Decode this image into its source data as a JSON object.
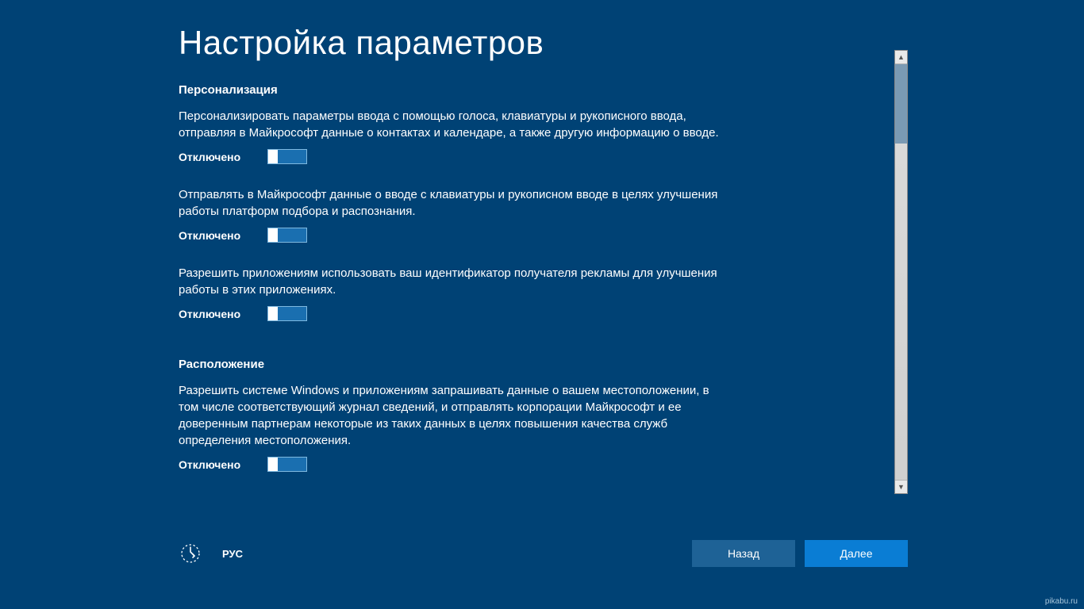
{
  "title": "Настройка параметров",
  "sections": {
    "personalization": {
      "heading": "Персонализация",
      "items": [
        {
          "desc": "Персонализировать параметры ввода с помощью голоса, клавиатуры и рукописного ввода, отправляя в Майкрософт данные о контактах и календаре, а также другую информацию о вводе.",
          "state": "Отключено"
        },
        {
          "desc": "Отправлять в Майкрософт данные о вводе с клавиатуры и рукописном вводе в целях улучшения работы платформ подбора и распознания.",
          "state": "Отключено"
        },
        {
          "desc": "Разрешить приложениям использовать ваш идентификатор получателя рекламы для улучшения работы в этих приложениях.",
          "state": "Отключено"
        }
      ]
    },
    "location": {
      "heading": "Расположение",
      "items": [
        {
          "desc": "Разрешить системе Windows и приложениям запрашивать данные о вашем местоположении, в том числе соответствующий журнал сведений, и отправлять корпорации Майкрософт и ее доверенным партнерам некоторые из таких данных в целях повышения качества служб определения местоположения.",
          "state": "Отключено"
        }
      ]
    }
  },
  "footer": {
    "language": "РУС",
    "back": "Назад",
    "next": "Далее"
  },
  "watermark": "pikabu.ru"
}
